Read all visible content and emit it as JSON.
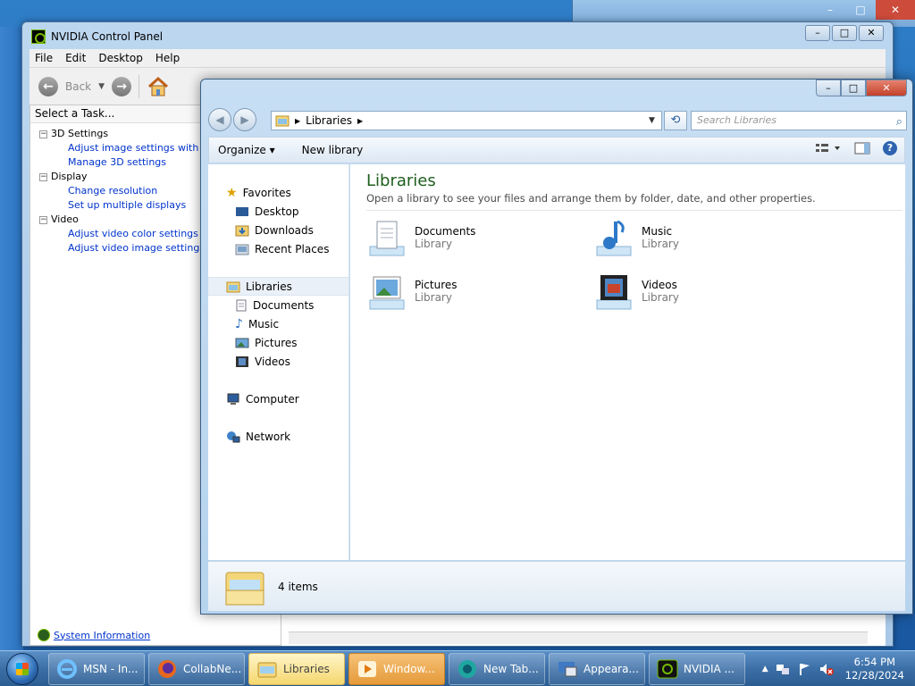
{
  "background_window": {
    "min": "–",
    "max": "□",
    "close": "✕"
  },
  "nvidia": {
    "title": "NVIDIA Control Panel",
    "menu": [
      "File",
      "Edit",
      "Desktop",
      "Help"
    ],
    "back_label": "Back",
    "task_header": "Select a Task...",
    "tree": [
      {
        "group": "3D Settings",
        "items": [
          "Adjust image settings with preview",
          "Manage 3D settings"
        ]
      },
      {
        "group": "Display",
        "items": [
          "Change resolution",
          "Set up multiple displays"
        ]
      },
      {
        "group": "Video",
        "items": [
          "Adjust video color settings",
          "Adjust video image settings"
        ]
      }
    ],
    "system_info": "System Information",
    "caps": {
      "min": "–",
      "max": "□",
      "close": "✕"
    }
  },
  "explorer": {
    "caps": {
      "min": "–",
      "max": "□",
      "close": "✕"
    },
    "address": "Libraries",
    "search_placeholder": "Search Libraries",
    "organize": "Organize ▾",
    "new_library": "New library",
    "help": "?",
    "nav": {
      "favorites": "Favorites",
      "fav_items": [
        "Desktop",
        "Downloads",
        "Recent Places"
      ],
      "libraries": "Libraries",
      "lib_items": [
        "Documents",
        "Music",
        "Pictures",
        "Videos"
      ],
      "computer": "Computer",
      "network": "Network"
    },
    "content": {
      "title": "Libraries",
      "subtitle": "Open a library to see your files and arrange them by folder, date, and other properties.",
      "tiles": [
        {
          "name": "Documents",
          "type": "Library"
        },
        {
          "name": "Music",
          "type": "Library"
        },
        {
          "name": "Pictures",
          "type": "Library"
        },
        {
          "name": "Videos",
          "type": "Library"
        }
      ]
    },
    "status": "4 items"
  },
  "taskbar": {
    "buttons": [
      "MSN - In...",
      "CollabNe...",
      "Libraries",
      "Window...",
      "New Tab...",
      "Appeara...",
      "NVIDIA ..."
    ],
    "time": "6:54 PM",
    "date": "12/28/2024"
  }
}
